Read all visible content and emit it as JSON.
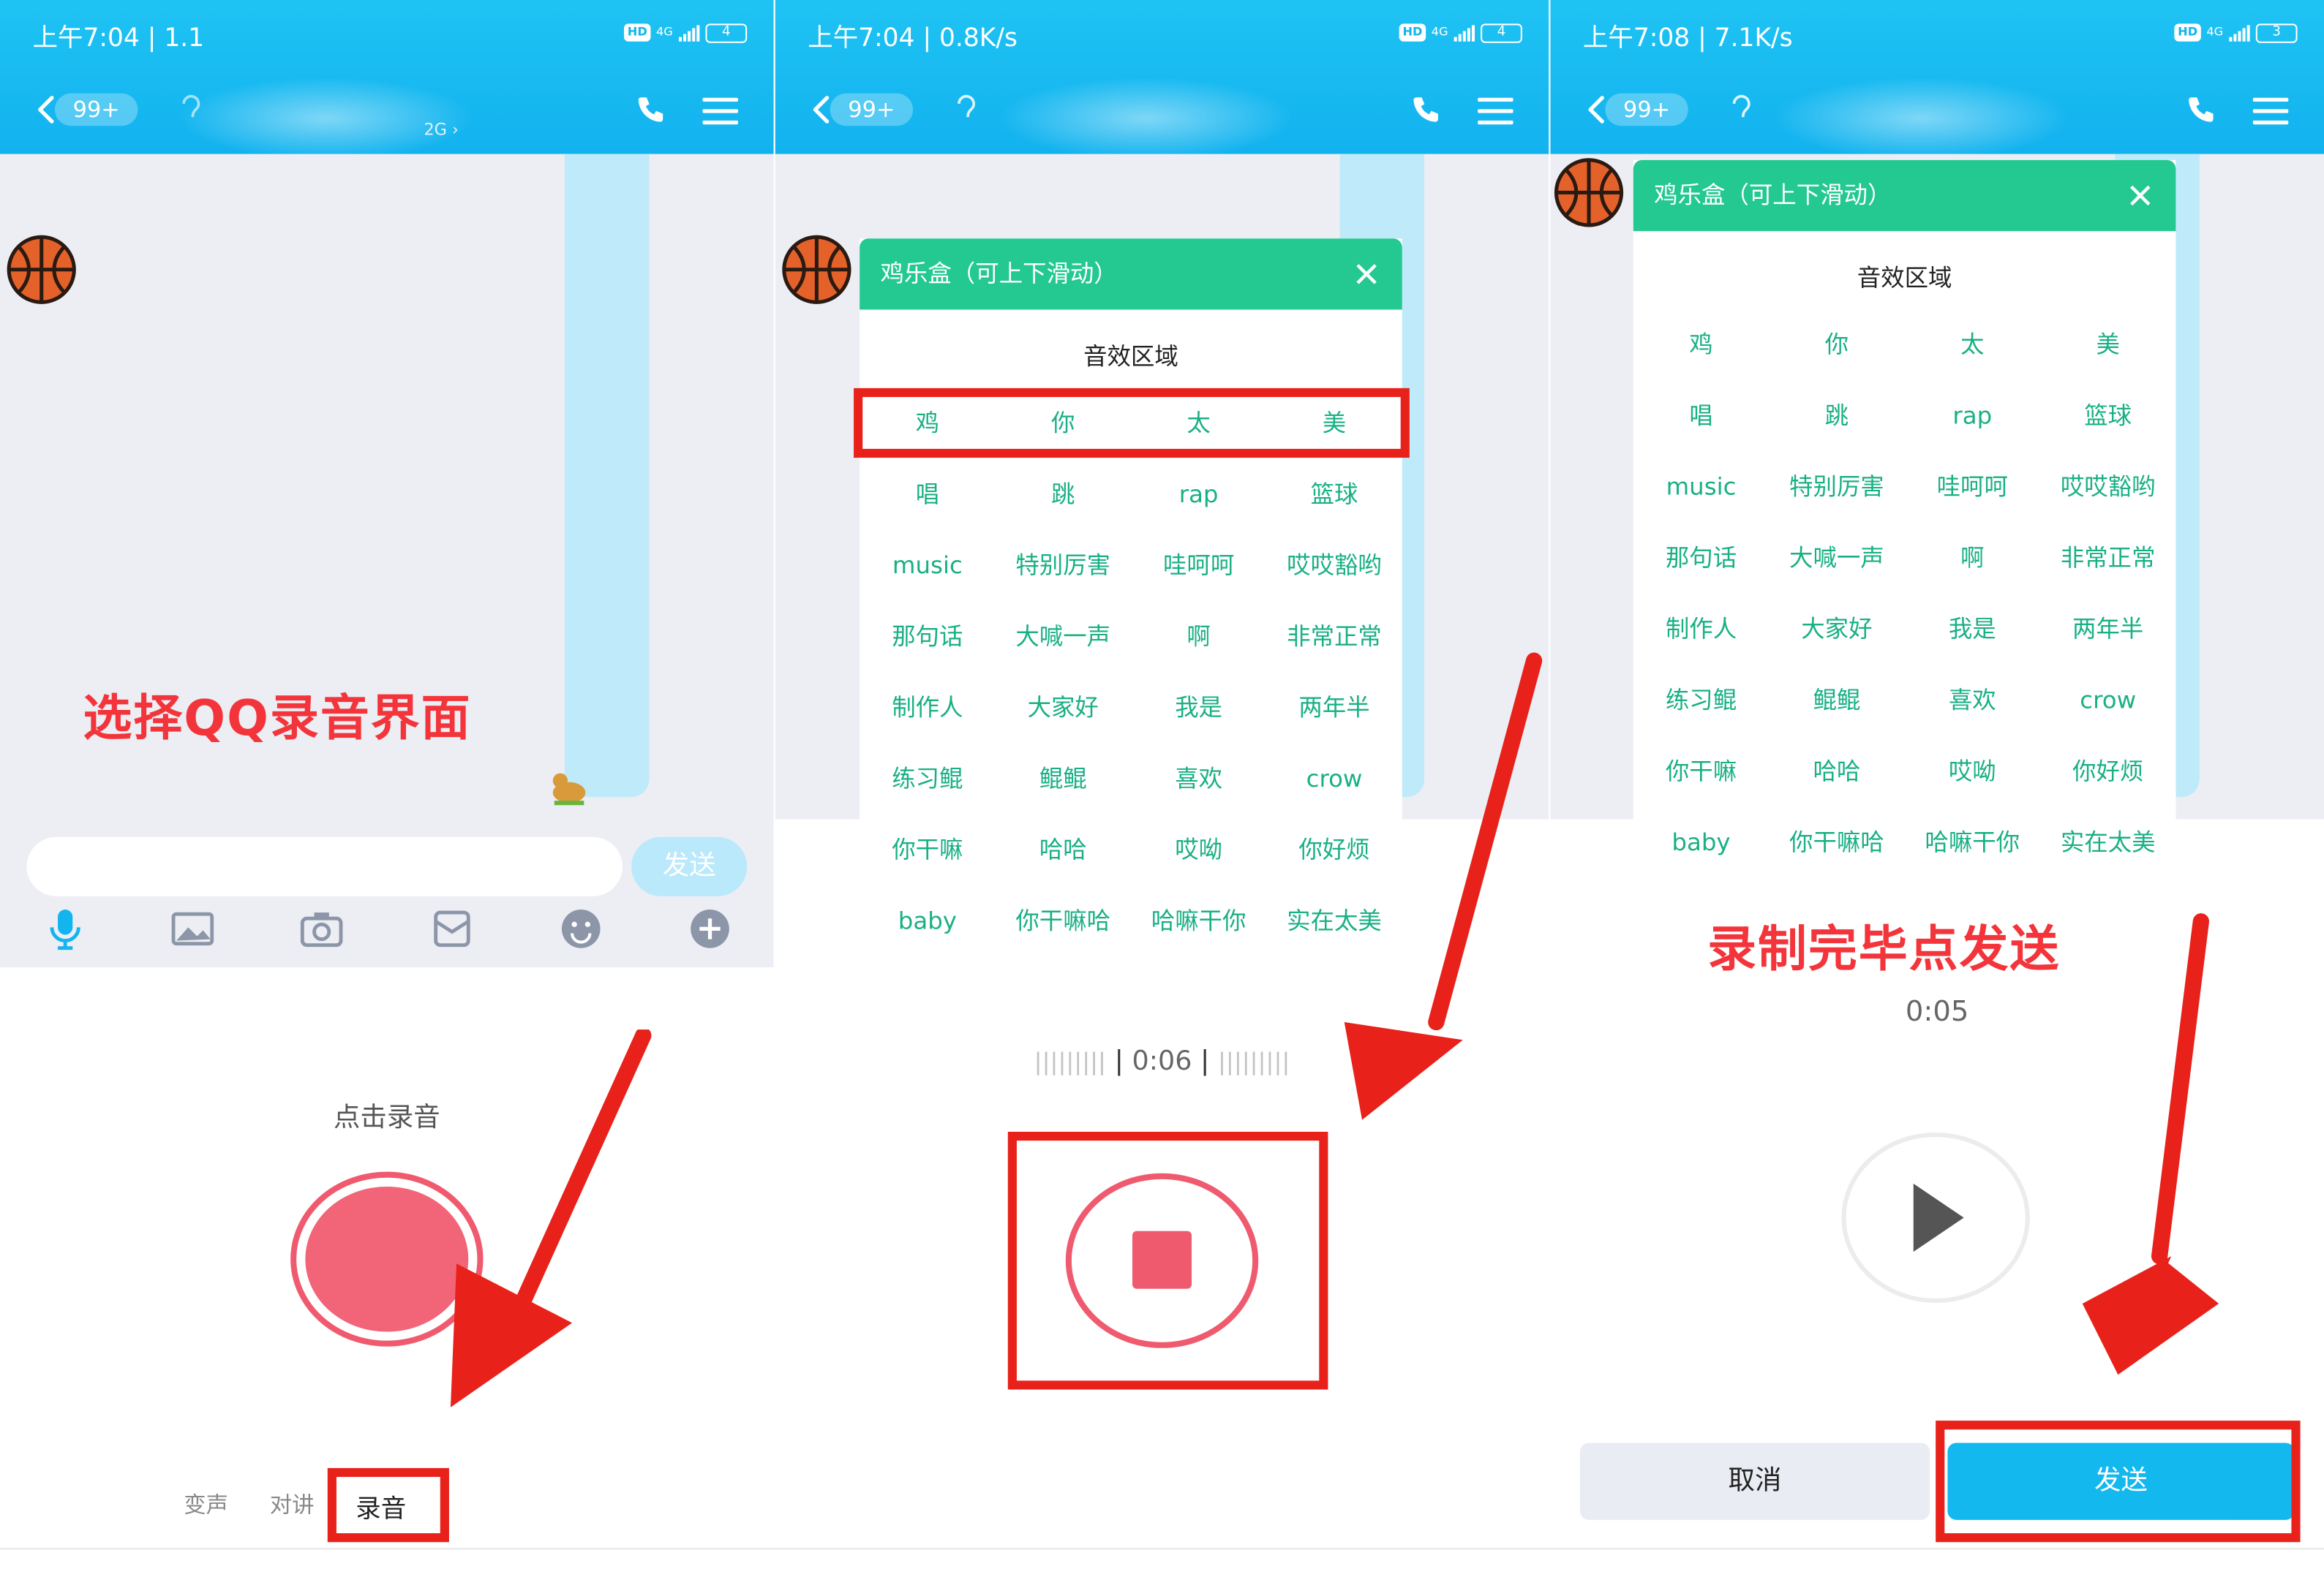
{
  "colors": {
    "qq_blue": "#12b2ef",
    "panel_green": "#23c990",
    "sound_text": "#19b084",
    "record_red": "#f05a6e",
    "annotation_red": "#e8221b"
  },
  "screens": [
    {
      "status": {
        "time": "上午7:04 | 1.1",
        "net": "4G",
        "battery": "4"
      },
      "header": {
        "badge": "99+",
        "subtitle": "2G ›"
      },
      "input": {
        "send": "发送"
      },
      "toolbar_icons": [
        "microphone-icon",
        "image-icon",
        "camera-icon",
        "red-packet-icon",
        "emoji-icon",
        "plus-icon"
      ],
      "overlay_title": "选择QQ录音界面",
      "record_hint": "点击录音",
      "tabs": [
        "变声",
        "对讲",
        "录音"
      ]
    },
    {
      "status": {
        "time": "上午7:04 | 0.8K/s",
        "net": "4G",
        "battery": "4"
      },
      "header": {
        "badge": "99+"
      },
      "panel_title": "鸡乐盒（可上下滑动）",
      "section_title": "音效区域",
      "timer": "0:06",
      "wave_left": "|||||||||",
      "wave_right": "|||||||||"
    },
    {
      "status": {
        "time": "上午7:08 | 7.1K/s",
        "net": "4G",
        "battery": "3"
      },
      "header": {
        "badge": "99+"
      },
      "panel_title": "鸡乐盒（可上下滑动）",
      "section_title": "音效区域",
      "overlay_title": "录制完毕点发送",
      "timer": "0:05",
      "cancel": "取消",
      "send": "发送"
    }
  ],
  "sounds": [
    [
      "鸡",
      "你",
      "太",
      "美"
    ],
    [
      "唱",
      "跳",
      "rap",
      "篮球"
    ],
    [
      "music",
      "特别厉害",
      "哇呵呵",
      "哎哎豁哟"
    ],
    [
      "那句话",
      "大喊一声",
      "啊",
      "非常正常"
    ],
    [
      "制作人",
      "大家好",
      "我是",
      "两年半"
    ],
    [
      "练习鲲",
      "鲲鲲",
      "喜欢",
      "crow"
    ],
    [
      "你干嘛",
      "哈哈",
      "哎呦",
      "你好烦"
    ],
    [
      "baby",
      "你干嘛哈",
      "哈嘛干你",
      "实在太美"
    ]
  ]
}
